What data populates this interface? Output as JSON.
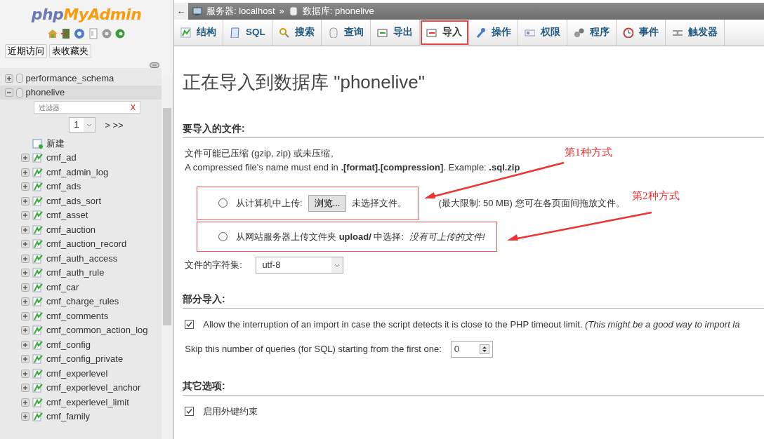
{
  "sidebar": {
    "logo": {
      "prefix": "php",
      "suffix": "MyAdmin"
    },
    "tabs": [
      {
        "label": "近期访问"
      },
      {
        "label": "表收藏夹"
      }
    ],
    "tree": [
      {
        "label": "performance_schema",
        "expanded": false
      },
      {
        "label": "phonelive",
        "expanded": true,
        "filter": {
          "placeholder": "过滤器",
          "clear": "X"
        },
        "pager": {
          "page": "1",
          "next": "> >>"
        },
        "children": [
          {
            "label": "新建",
            "kind": "new"
          },
          {
            "label": "cmf_ad",
            "kind": "table"
          },
          {
            "label": "cmf_admin_log",
            "kind": "table"
          },
          {
            "label": "cmf_ads",
            "kind": "table"
          },
          {
            "label": "cmf_ads_sort",
            "kind": "table"
          },
          {
            "label": "cmf_asset",
            "kind": "table"
          },
          {
            "label": "cmf_auction",
            "kind": "table"
          },
          {
            "label": "cmf_auction_record",
            "kind": "table"
          },
          {
            "label": "cmf_auth_access",
            "kind": "table"
          },
          {
            "label": "cmf_auth_rule",
            "kind": "table"
          },
          {
            "label": "cmf_car",
            "kind": "table"
          },
          {
            "label": "cmf_charge_rules",
            "kind": "table"
          },
          {
            "label": "cmf_comments",
            "kind": "table"
          },
          {
            "label": "cmf_common_action_log",
            "kind": "table"
          },
          {
            "label": "cmf_config",
            "kind": "table"
          },
          {
            "label": "cmf_config_private",
            "kind": "table"
          },
          {
            "label": "cmf_experlevel",
            "kind": "table"
          },
          {
            "label": "cmf_experlevel_anchor",
            "kind": "table"
          },
          {
            "label": "cmf_experlevel_limit",
            "kind": "table"
          },
          {
            "label": "cmf_family",
            "kind": "table"
          }
        ]
      }
    ]
  },
  "breadcrumb": {
    "back": "←",
    "separator": "»",
    "items": [
      {
        "label": "服务器: localhost"
      },
      {
        "label": "数据库: phonelive"
      }
    ]
  },
  "menu_tabs": [
    {
      "label": "结构",
      "selected": false,
      "highlighted": false
    },
    {
      "label": "SQL",
      "selected": false,
      "highlighted": false
    },
    {
      "label": "搜索",
      "selected": false,
      "highlighted": false
    },
    {
      "label": "查询",
      "selected": false,
      "highlighted": false
    },
    {
      "label": "导出",
      "selected": false,
      "highlighted": false
    },
    {
      "label": "导入",
      "selected": true,
      "highlighted": true
    },
    {
      "label": "操作",
      "selected": false,
      "highlighted": false
    },
    {
      "label": "权限",
      "selected": false,
      "highlighted": false
    },
    {
      "label": "程序",
      "selected": false,
      "highlighted": false
    },
    {
      "label": "事件",
      "selected": false,
      "highlighted": false
    },
    {
      "label": "触发器",
      "selected": false,
      "highlighted": false
    }
  ],
  "page_title": "正在导入到数据库 \"phonelive\"",
  "file_section": {
    "heading": "要导入的文件:",
    "notes": [
      "文件可能已压缩 (gzip, zip) 或未压缩。",
      "A compressed file's name must end in **.[format].[compression]**. Example: **.sql.zip**"
    ],
    "sources": [
      {
        "kind": "upload",
        "label": "从计算机中上传:",
        "selected": false,
        "highlighted": true,
        "browse": "浏览...",
        "file_status": "未选择文件。",
        "limit": "(最大限制: 50 MB) 您可在各页面间拖放文件。"
      },
      {
        "kind": "server",
        "label": "从网站服务器上传文件夹 **upload/** 中选择:",
        "selected": false,
        "highlighted": true,
        "status": "没有可上传的文件!"
      }
    ],
    "charset": {
      "label": "文件的字符集:",
      "value": "utf-8"
    }
  },
  "partial_section": {
    "heading": "部分导入:",
    "allow_interrupt": {
      "checked": true,
      "label": "Allow the interruption of an import in case the script detects it is close to the PHP timeout limit. *(This might be a good way to import la*"
    },
    "skip": {
      "label": "Skip this number of queries (for SQL) starting from the first one:",
      "value": "0"
    }
  },
  "other_section": {
    "heading": "其它选项:",
    "foreign_keys": {
      "checked": true,
      "label": "启用外键约束"
    }
  },
  "annotations": [
    {
      "label": "第1种方式"
    },
    {
      "label": "第2种方式"
    }
  ]
}
